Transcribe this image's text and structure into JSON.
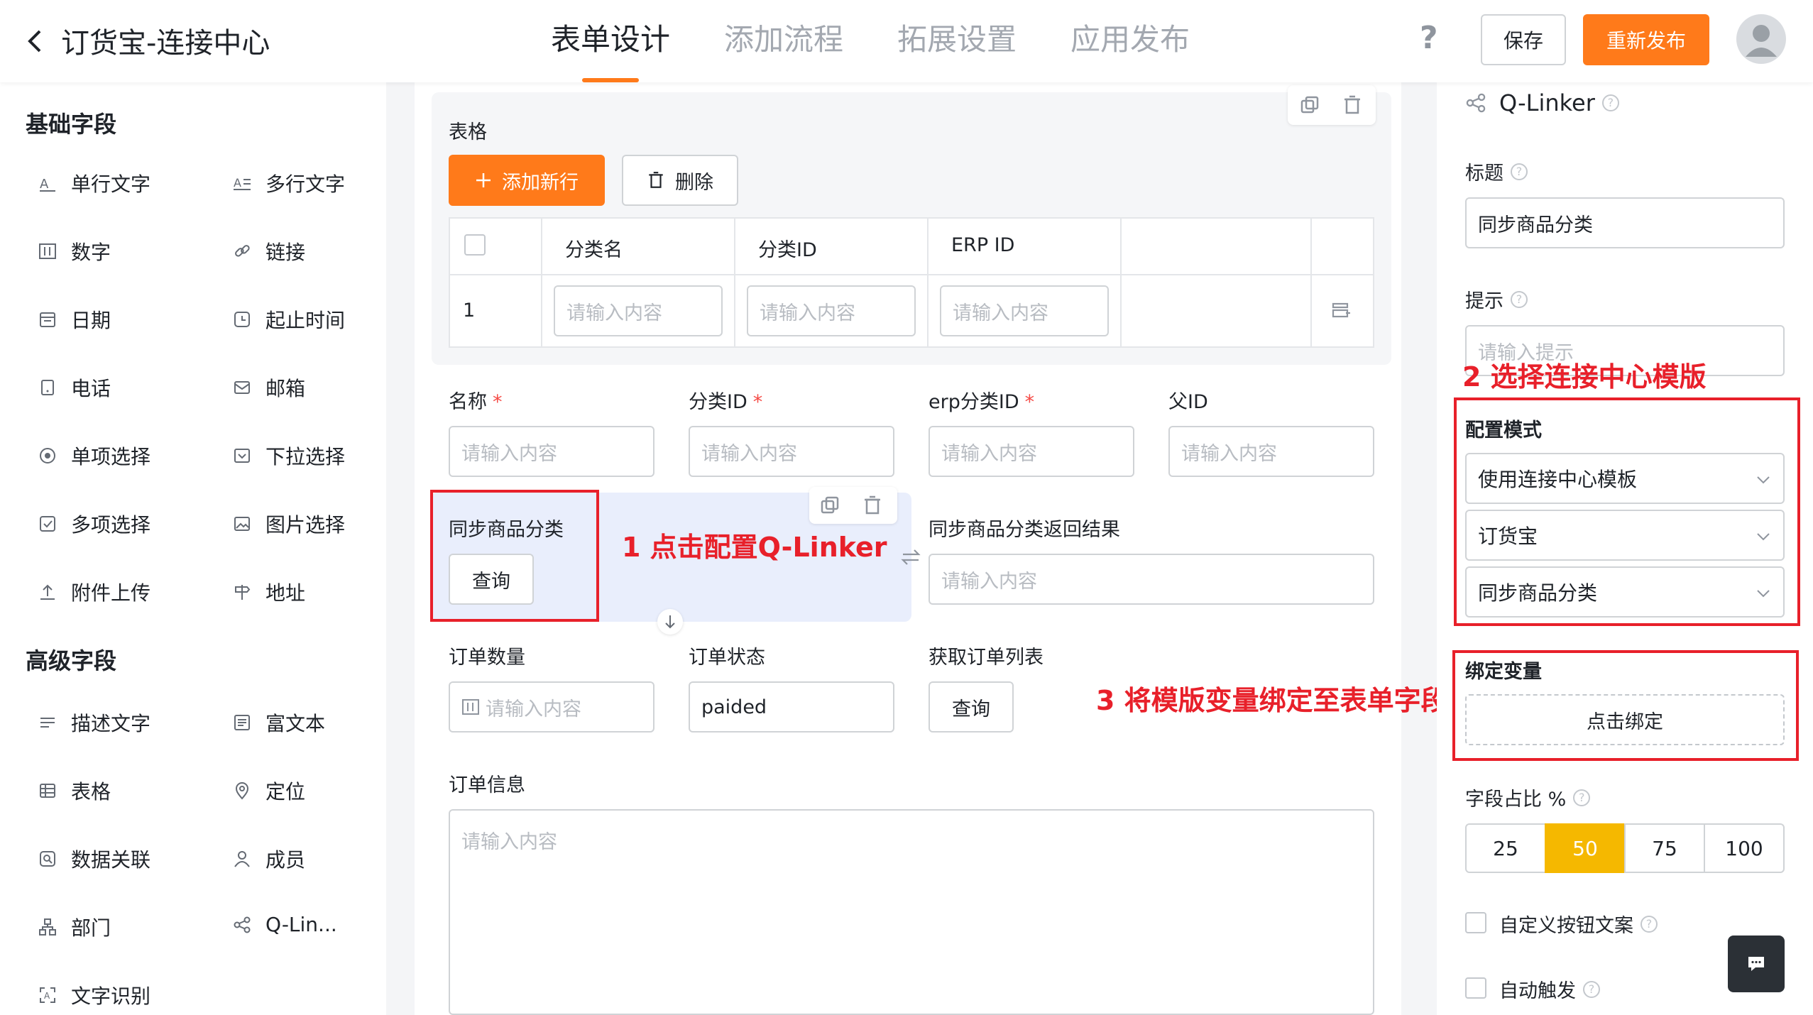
{
  "header": {
    "title": "订货宝-连接中心",
    "steps": [
      "表单设计",
      "添加流程",
      "拓展设置",
      "应用发布"
    ],
    "help": "?",
    "save_label": "保存",
    "republish_label": "重新发布"
  },
  "sidebar": {
    "basic_title": "基础字段",
    "basic_items": [
      "单行文字",
      "多行文字",
      "数字",
      "链接",
      "日期",
      "起止时间",
      "电话",
      "邮箱",
      "单项选择",
      "下拉选择",
      "多项选择",
      "图片选择",
      "附件上传",
      "地址"
    ],
    "advanced_title": "高级字段",
    "advanced_items": [
      "描述文字",
      "富文本",
      "表格",
      "定位",
      "数据关联",
      "成员",
      "部门",
      "Q-Lin...",
      "文字识别"
    ]
  },
  "table": {
    "title": "表格",
    "add_row_label": "添加新行",
    "delete_label": "删除",
    "columns": [
      "分类名",
      "分类ID",
      "ERP ID"
    ],
    "row_index": "1",
    "cell_placeholder": "请输入内容"
  },
  "form": {
    "placeholder": "请输入内容",
    "name_label": "名称",
    "category_id_label": "分类ID",
    "erp_category_id_label": "erp分类ID",
    "parent_id_label": "父ID",
    "required_mark": "*",
    "sync_label": "同步商品分类",
    "query_label": "查询",
    "sync_result_label": "同步商品分类返回结果",
    "order_qty_label": "订单数量",
    "order_status_label": "订单状态",
    "order_status_value": "paided",
    "order_list_label": "获取订单列表",
    "order_info_label": "订单信息"
  },
  "annotations": {
    "step1": "1 点击配置Q-Linker",
    "step2": "2 选择连接中心模版",
    "step3": "3 将模版变量绑定至表单字段"
  },
  "props": {
    "component_name": "Q-Linker",
    "title_label": "标题",
    "title_value": "同步商品分类",
    "hint_label": "提示",
    "hint_placeholder": "请输入提示",
    "config_mode_label": "配置模式",
    "config_mode_value": "使用连接中心模板",
    "app_value": "订货宝",
    "template_value": "同步商品分类",
    "bind_label": "绑定变量",
    "bind_button": "点击绑定",
    "width_label": "字段占比 %",
    "width_options": [
      "25",
      "50",
      "75",
      "100"
    ],
    "width_selected": "50",
    "custom_button_label": "自定义按钮文案",
    "auto_trigger_label": "自动触发"
  },
  "colors": {
    "accent": "#ff7a1a",
    "annotation": "#e8202a",
    "segment_active": "#f5b800"
  }
}
